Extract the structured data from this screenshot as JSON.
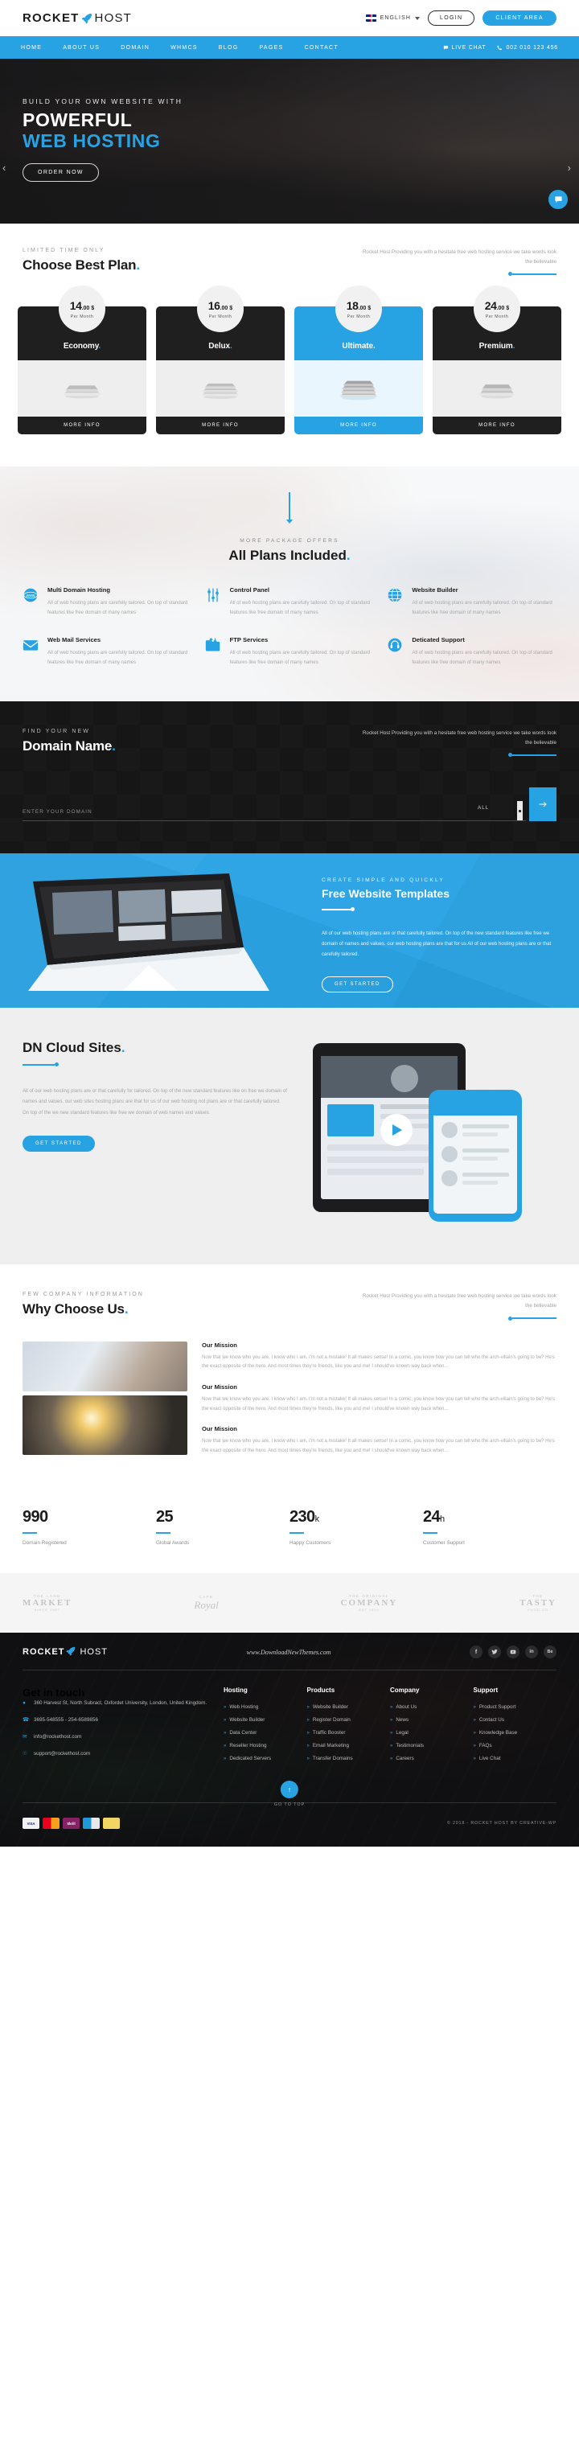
{
  "brand": {
    "name_a": "ROCKET",
    "name_b": "HOST",
    "rocket_icon": "rocket-icon"
  },
  "topbar": {
    "language": "ENGLISH",
    "login_label": "LOGIN",
    "client_area_label": "CLIENT AREA"
  },
  "nav": {
    "items": [
      "HOME",
      "ABOUT US",
      "DOMAIN",
      "WHMCS",
      "BLOG",
      "PAGES",
      "CONTACT"
    ],
    "live_chat": "LIVE CHAT",
    "phone": "002 010 123 456"
  },
  "hero": {
    "kicker": "BUILD YOUR OWN WEBSITE WITH",
    "line1": "POWERFUL",
    "line2": "WEB HOSTING",
    "cta": "ORDER NOW",
    "prev_icon": "chevron-left-icon",
    "next_icon": "chevron-right-icon",
    "chat_icon": "chat-bubble-icon"
  },
  "pricing": {
    "kicker": "LIMITED TIME ONLY",
    "title": "Choose Best Plan",
    "desc": "Rocket Host Providing you with a hesitate free web hosting service we take words look the believable",
    "per_month": "Per Month",
    "currency": "$",
    "button_label": "MORE INFO",
    "plans": [
      {
        "name": "Economy",
        "price_int": "14",
        "price_dec": ".00",
        "featured": false
      },
      {
        "name": "Delux",
        "price_int": "16",
        "price_dec": ".00",
        "featured": false
      },
      {
        "name": "Ultimate",
        "price_int": "18",
        "price_dec": ".00",
        "featured": true
      },
      {
        "name": "Premium",
        "price_int": "24",
        "price_dec": ".00",
        "featured": false
      }
    ]
  },
  "included": {
    "kicker": "MORE PACKAGE OFFERS",
    "title": "All Plans Included",
    "desc": "All of web hosting plans are carefully tailored. On top of standard features like free domain of many names",
    "features": [
      {
        "title": "Multi Domain Hosting",
        "icon": "www-globe-icon"
      },
      {
        "title": "Control Panel",
        "icon": "sliders-icon"
      },
      {
        "title": "Website Builder",
        "icon": "globe-grid-icon"
      },
      {
        "title": "Web Mail Services",
        "icon": "envelope-icon"
      },
      {
        "title": "FTP Services",
        "icon": "ftp-folder-icon"
      },
      {
        "title": "Deticated Support",
        "icon": "headset-icon"
      }
    ]
  },
  "domain": {
    "kicker": "FIND YOUR NEW",
    "title": "Domain Name",
    "desc": "Rocket Host Providing you with a hesitate free web hosting service we take words look the believable",
    "placeholder": "ENTER YOUR DOMAIN",
    "select_value": "ALL",
    "go_icon": "arrow-right-icon"
  },
  "templates": {
    "kicker": "CREATE SIMPLE AND QUICKLY",
    "title": "Free Website Templates",
    "desc": "All of our web hosting plans are or that carefully tailored. On top of the new standard features like free we domain of names and values. our web hosting plans are that for us All of our web hosting plans are or that carefully tailored.",
    "cta": "GET STARTED"
  },
  "dncloud": {
    "title": "DN Cloud Sites",
    "desc": "All of our web hosting plans are or that carefully for tailored. On top of the new standard features like on free we domain of names and values. our web sites hosting plans are that for us  of our web hosting not plans are or that carefully tailored. On top of the we new standard features like free we domain of web names and values.",
    "cta": "GET STARTED",
    "play_icon": "play-icon"
  },
  "why": {
    "kicker": "FEW COMPANY INFORMATION",
    "title": "Why Choose Us",
    "desc": "Rocket Host Providing you with a hesitate free web hosting service we take words look the believable",
    "missions": [
      {
        "title": "Our Mission",
        "text": "Now that we know who you are, I know who I am. I'm not a mistake! It all makes sense! In a comic, you know how you can tell who the arch-villain's going to be? He's the exact opposite of the hero. And most times they're friends, like you and me! I should've known way back when..."
      },
      {
        "title": "Our Mission",
        "text": "Now that we know who you are, I know who I am. I'm not a mistake! It all makes sense! In a comic, you know how you can tell who the arch-villain's going to be? He's the exact opposite of the hero. And most times they're friends, like you and me! I should've known way back when..."
      },
      {
        "title": "Our Mission",
        "text": "Now that we know who you are, I know who I am. I'm not a mistake! It all makes sense! In a comic, you know how you can tell who the arch-villain's going to be? He's the exact opposite of the hero. And most times they're friends, like you and me! I should've known way back when..."
      }
    ]
  },
  "stats": [
    {
      "num": "990",
      "suffix": "",
      "label": "Domain Registered"
    },
    {
      "num": "25",
      "suffix": "",
      "label": "Global Awards"
    },
    {
      "num": "230",
      "suffix": "k",
      "label": "Happy Customers"
    },
    {
      "num": "24",
      "suffix": "h",
      "label": "Customer Support"
    }
  ],
  "brands": [
    {
      "top": "THE LAND",
      "main": "MARKET",
      "bottom": "SINCE 1987"
    },
    {
      "top": "",
      "main": "Royal",
      "bottom": "CAFE"
    },
    {
      "top": "THE ORIGINAL",
      "main": "COMPANY",
      "bottom": "EST 1924"
    },
    {
      "top": "THE",
      "main": "TASTY",
      "bottom": "FOOD CO"
    }
  ],
  "footer": {
    "site": "www.DownloadNewThemes.com",
    "socials": [
      "facebook-icon",
      "twitter-icon",
      "youtube-icon",
      "linkedin-icon",
      "behance-icon"
    ],
    "contact": {
      "heading": "Get in touch",
      "address": "360 Harvest St, North Subract, Oxfordet University, London, United Kingdom.",
      "phone": "3695-548555 - 254-6589856",
      "email": "info@rockethost.com",
      "support": "support@rockethost.com"
    },
    "columns": [
      {
        "heading": "Hosting",
        "links": [
          "Web Hosting",
          "Website Builder",
          "Data Center",
          "Reseller Hosting",
          "Dedicated Servers"
        ]
      },
      {
        "heading": "Products",
        "links": [
          "Website Builder",
          "Register Domain",
          "Traffic Booster",
          "Email Marketing",
          "Transfer Domains"
        ]
      },
      {
        "heading": "Company",
        "links": [
          "About Us",
          "News",
          "Legal",
          "Testimonials",
          "Careers"
        ]
      },
      {
        "heading": "Support",
        "links": [
          "Product Support",
          "Contact Us",
          "Knowledge Base",
          "FAQs",
          "Live Chat"
        ]
      }
    ],
    "go_to_top": "GO TO TOP",
    "copyright": "© 2018 - ROCKET HOST BY CREATIVE-WP",
    "cards": [
      "VISA",
      "MC",
      "Skrill",
      "AMEX",
      "PAY"
    ]
  },
  "colors": {
    "accent": "#27a2e3",
    "dark": "#1f1f1f",
    "footer_bg": "#101012"
  }
}
